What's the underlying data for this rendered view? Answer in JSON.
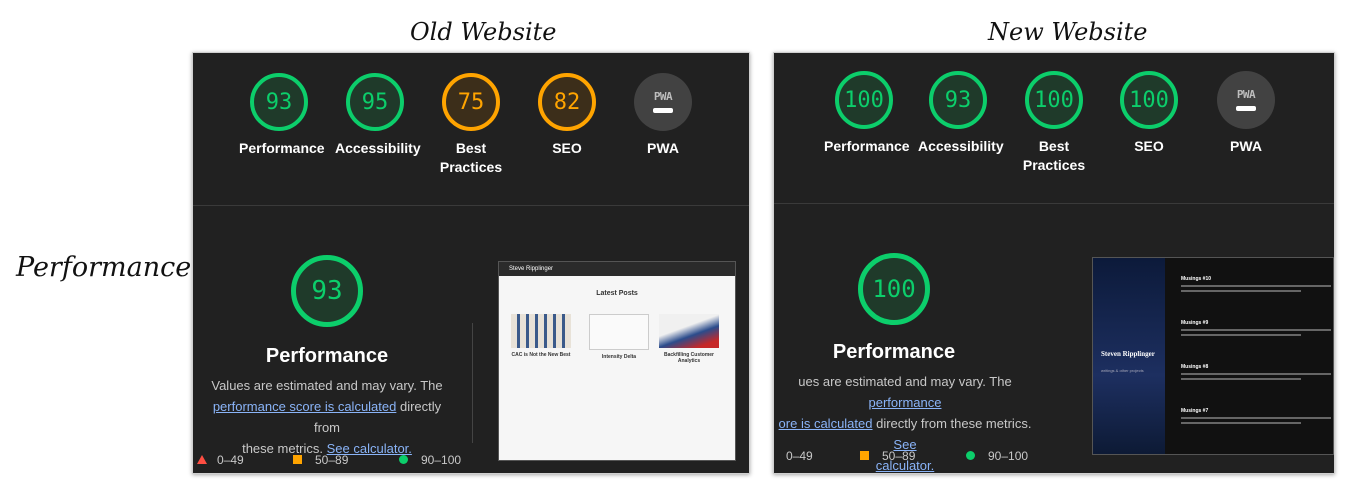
{
  "labels": {
    "old_website": "Old Website",
    "new_website": "New Website",
    "performance_side": "Performance"
  },
  "old": {
    "gauges": [
      {
        "value": "93",
        "label": "Performance",
        "status": "pass"
      },
      {
        "value": "95",
        "label": "Accessibility",
        "status": "pass"
      },
      {
        "value": "75",
        "label": "Best Practices",
        "status": "average"
      },
      {
        "value": "82",
        "label": "SEO",
        "status": "average"
      },
      {
        "value": "PWA",
        "label": "PWA",
        "status": "pwa"
      }
    ],
    "perf_score": "93",
    "perf_title": "Performance",
    "desc_1": "Values are estimated and may vary. The",
    "desc_link_1": "performance score is calculated",
    "desc_2": " directly from",
    "desc_3": "these metrics. ",
    "desc_link_2": "See calculator.",
    "legend": [
      "0–49",
      "50–89",
      "90–100"
    ],
    "thumb": {
      "site_name": "Steve Ripplinger",
      "heading": "Latest Posts",
      "cards": [
        "CAC is Not the New Best",
        "Intensity Delta",
        "Backfilling Customer Analytics"
      ]
    }
  },
  "new": {
    "gauges": [
      {
        "value": "100",
        "label": "Performance",
        "status": "pass"
      },
      {
        "value": "93",
        "label": "Accessibility",
        "status": "pass"
      },
      {
        "value": "100",
        "label": "Best Practices",
        "status": "pass"
      },
      {
        "value": "100",
        "label": "SEO",
        "status": "pass"
      },
      {
        "value": "PWA",
        "label": "PWA",
        "status": "pwa"
      }
    ],
    "perf_score": "100",
    "perf_title": "Performance",
    "desc_1": "ues are estimated and may vary. The ",
    "desc_link_1": "performance",
    "desc_link_1b": "ore is calculated",
    "desc_2": " directly from these metrics. ",
    "desc_link_2": "See",
    "desc_link_2b": "calculator.",
    "legend": [
      "0–49",
      "50–89",
      "90–100"
    ],
    "thumb": {
      "name": "Steven Ripplinger",
      "sub": "writings & other projects",
      "posts": [
        "Musings #10",
        "Musings #9",
        "Musings #8",
        "Musings #7"
      ]
    }
  },
  "colors": {
    "pass": "#0cce6b",
    "average": "#ffa400",
    "fail": "#ff4e42",
    "panel": "#212121"
  }
}
